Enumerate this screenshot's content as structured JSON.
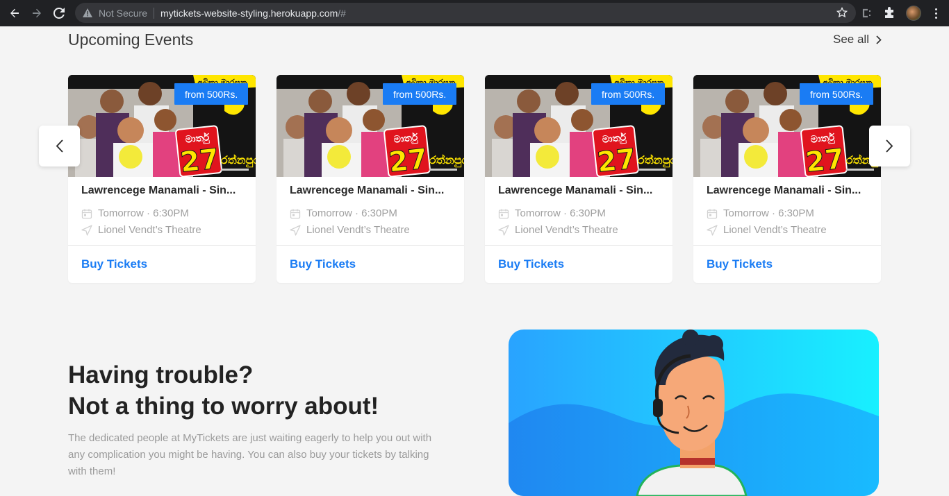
{
  "browser": {
    "security_label": "Not Secure",
    "url_host": "mytickets-website-styling.herokuapp.com",
    "url_path": "/#"
  },
  "upcoming": {
    "title": "Upcoming Events",
    "see_all": "See all"
  },
  "events": [
    {
      "price": "from 500Rs.",
      "title": "Lawrencege Manamali - Sin...",
      "date": "Tomorrow · 6:30PM",
      "venue": "Lionel Vendt’s Theatre",
      "cta": "Buy Tickets"
    },
    {
      "price": "from 500Rs.",
      "title": "Lawrencege Manamali - Sin...",
      "date": "Tomorrow · 6:30PM",
      "venue": "Lionel Vendt’s Theatre",
      "cta": "Buy Tickets"
    },
    {
      "price": "from 500Rs.",
      "title": "Lawrencege Manamali - Sin...",
      "date": "Tomorrow · 6:30PM",
      "venue": "Lionel Vendt’s Theatre",
      "cta": "Buy Tickets"
    },
    {
      "price": "from 500Rs.",
      "title": "Lawrencege Manamali - Sin...",
      "date": "Tomorrow · 6:30PM",
      "venue": "Lionel Vendt’s Theatre",
      "cta": "Buy Tickets"
    }
  ],
  "poster": {
    "top_text": "අබිකා මාරපන",
    "month": "මාර්තු",
    "day": "27",
    "venue_text": "රත්නපුර"
  },
  "help": {
    "heading_line1": "Having trouble?",
    "heading_line2": "Not a thing to worry about!",
    "body": "The dedicated people at MyTickets are just waiting eagerly to help you out with any complication you might be having. You can also buy your tickets by talking with them!"
  },
  "colors": {
    "accent": "#1a7cf4",
    "badge_red": "#e0141e",
    "badge_yellow": "#ffe600"
  },
  "icons": {
    "back": "arrow-left-icon",
    "forward": "arrow-right-icon",
    "reload": "reload-icon",
    "warning": "warning-icon",
    "star": "star-icon",
    "extension": "puzzle-icon",
    "calendar": "calendar-icon",
    "location": "location-arrow-icon",
    "prev": "chevron-left-icon",
    "next": "chevron-right-icon"
  }
}
